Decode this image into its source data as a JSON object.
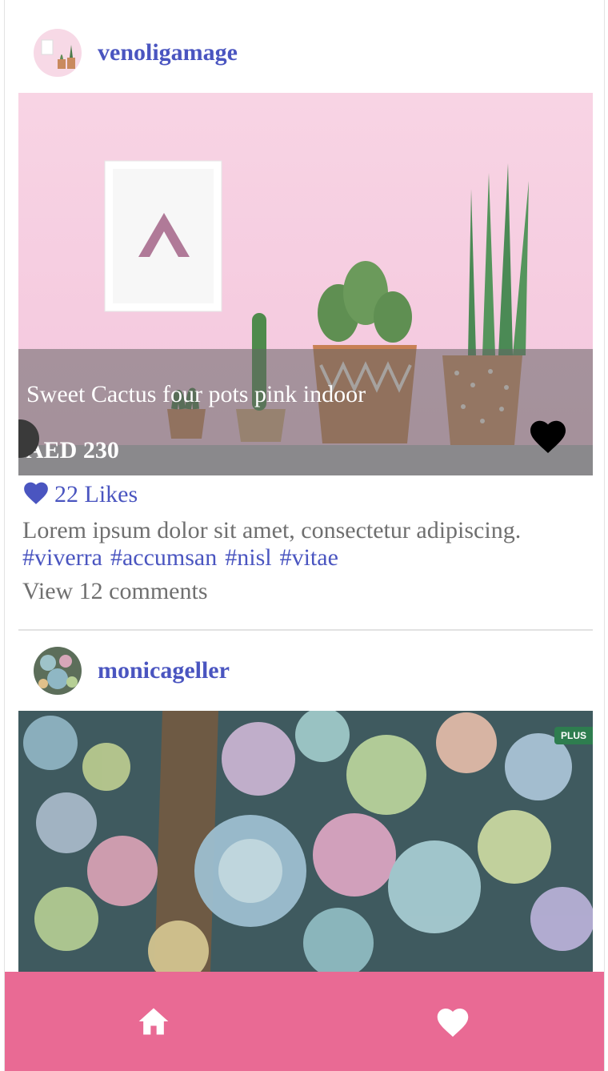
{
  "feed": {
    "posts": [
      {
        "username": "venoligamage",
        "title": "Sweet Cactus four pots pink indoor",
        "price": "AED 230",
        "likes": "22 Likes",
        "description": "Lorem ipsum dolor sit amet, consectetur adipiscing.",
        "tags": [
          "#viverra",
          "#accumsan",
          "#nisl",
          "#vitae"
        ],
        "comments": "View 12 comments"
      },
      {
        "username": "monicageller",
        "badge": "PLUS"
      }
    ]
  },
  "colors": {
    "accent": "#4a55c0",
    "tabbar": "#e96a94",
    "muted_text": "#6f6f6f"
  },
  "icons": {
    "like": "heart-icon",
    "favorite": "heart-icon",
    "home_tab": "home-icon",
    "favorites_tab": "heart-icon"
  }
}
